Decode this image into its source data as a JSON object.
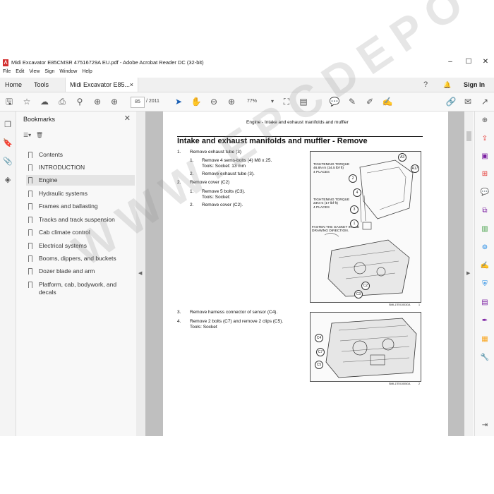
{
  "window": {
    "title": "Midi Excavator E85CMSR 47516729A EU.pdf - Adobe Acrobat Reader DC (32-bit)",
    "minimize": "–",
    "maximize": "☐",
    "close": "✕"
  },
  "menu": [
    "File",
    "Edit",
    "View",
    "Sign",
    "Window",
    "Help"
  ],
  "tabs": {
    "home": "Home",
    "tools": "Tools",
    "document": "Midi Excavator E85...",
    "doc_close": "×",
    "sign_in": "Sign In"
  },
  "toolbar": {
    "page_current": "85",
    "page_total": "/ 2011",
    "zoom": "77%"
  },
  "bookmarks": {
    "header": "Bookmarks",
    "items": [
      "Contents",
      "INTRODUCTION",
      "Engine",
      "Hydraulic systems",
      "Frames and ballasting",
      "Tracks and track suspension",
      "Cab climate control",
      "Electrical systems",
      "Booms, dippers, and buckets",
      "Dozer blade and arm",
      "Platform, cab, bodywork, and decals"
    ],
    "selected_index": 2
  },
  "document": {
    "running_header": "Engine - Intake and exhaust manifolds and muffler",
    "heading": "Intake and exhaust manifolds and muffler - Remove",
    "steps": [
      {
        "n": "1.",
        "text": "Remove exhaust tube (3)"
      },
      {
        "n": "1.",
        "text": "Remove 4 sems-bolts (4) M8 x 25."
      },
      {
        "n": "",
        "text": "Tools: Socket: 13 mm"
      },
      {
        "n": "2.",
        "text": "Remove exhaust tube (3)."
      },
      {
        "n": "2.",
        "text": "Remove cover (C2)"
      },
      {
        "n": "1.",
        "text": "Remove 5 bolts (C3)."
      },
      {
        "n": "",
        "text": "Tools: Socket:"
      },
      {
        "n": "2.",
        "text": "Remove cover (C2)."
      },
      {
        "n": "3.",
        "text": "Remove harness connector of sensor (C4)."
      },
      {
        "n": "4.",
        "text": "Remove 2 bolts (C7) and remove 2 clips (C5)."
      },
      {
        "n": "",
        "text": "Tools: Socket"
      }
    ],
    "figure1": {
      "torque1": [
        "TIGHTENING TORQUE",
        "46.8N·m (34.5 lbf·ft)",
        "4 PLACES"
      ],
      "torque2": [
        "TIGHTENING TORQUE",
        "23N·m (17 lbf·ft)",
        "4 PLACES"
      ],
      "gasket": [
        "FASTEN THE GASKET IN THE",
        "DRAWING DIRECTION."
      ],
      "callouts": [
        "A3",
        "A17",
        "2",
        "4",
        "3",
        "1",
        "C2",
        "C3"
      ],
      "caption": "SMIL17EX1003GA",
      "number": "1"
    },
    "figure2": {
      "callouts": [
        "C4",
        "C7",
        "C5"
      ],
      "caption": "SMIL17EX1005GA",
      "number": "2"
    }
  },
  "watermark": "WWW.EPCDEPOT.COM"
}
